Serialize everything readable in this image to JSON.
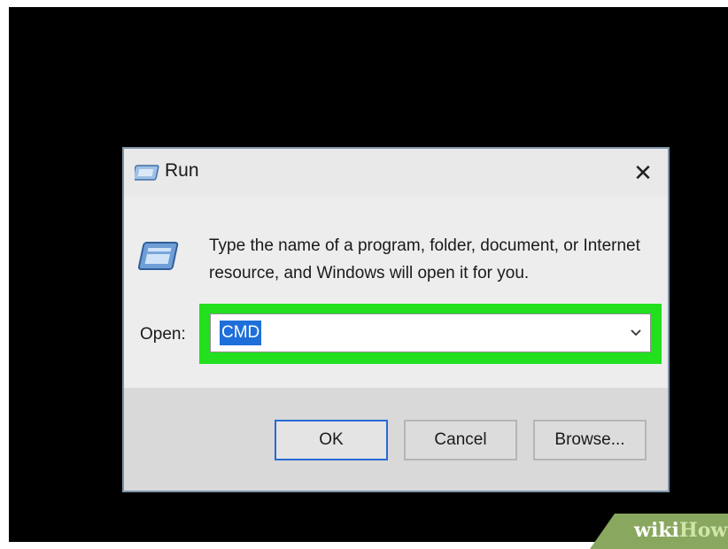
{
  "window": {
    "title": "Run",
    "icon": "run-icon",
    "close_icon": "close-icon"
  },
  "body": {
    "icon": "run-large-icon",
    "description": "Type the name of a program, folder, document, or Internet resource, and Windows will open it for you.",
    "open_label": "Open:",
    "open_value": "CMD",
    "dropdown_icon": "chevron-down-icon",
    "highlight_color": "#22e01e"
  },
  "buttons": {
    "ok": "OK",
    "cancel": "Cancel",
    "browse": "Browse..."
  },
  "watermark": {
    "wiki": "wiki",
    "how": "How"
  }
}
